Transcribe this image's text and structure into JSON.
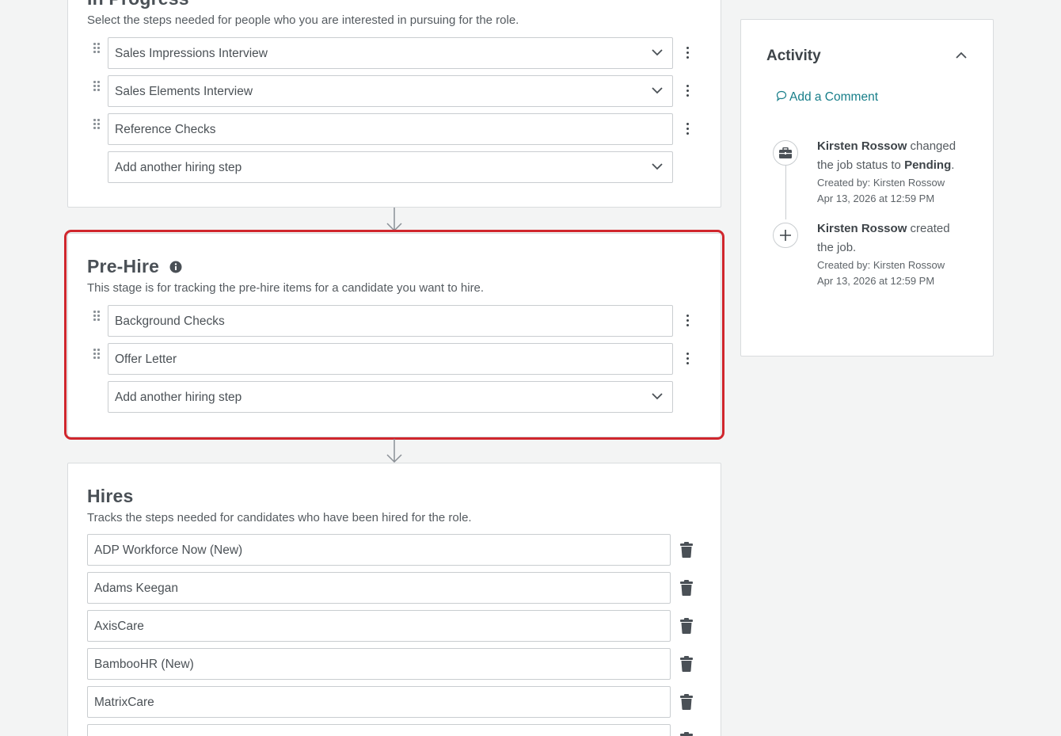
{
  "in_progress": {
    "title": "In Progress",
    "description": "Select the steps needed for people who you are interested in pursuing for the role.",
    "steps": [
      {
        "label": "Sales Impressions Interview"
      },
      {
        "label": "Sales Elements Interview"
      },
      {
        "label": "Reference Checks"
      }
    ],
    "add_step_label": "Add another hiring step"
  },
  "pre_hire": {
    "title": "Pre-Hire",
    "description": "This stage is for tracking the pre-hire items for a candidate you want to hire.",
    "steps": [
      {
        "label": "Background Checks"
      },
      {
        "label": "Offer Letter"
      }
    ],
    "add_step_label": "Add another hiring step",
    "highlight_color": "#d0262d"
  },
  "hires": {
    "title": "Hires",
    "description": "Tracks the steps needed for candidates who have been hired for the role.",
    "items": [
      {
        "label": "ADP Workforce Now (New)"
      },
      {
        "label": "Adams Keegan"
      },
      {
        "label": "AxisCare"
      },
      {
        "label": "BambooHR (New)"
      },
      {
        "label": "MatrixCare"
      },
      {
        "label": ""
      }
    ]
  },
  "activity": {
    "title": "Activity",
    "add_comment_label": "Add a Comment",
    "entries": [
      {
        "icon": "briefcase-icon",
        "actor": "Kirsten Rossow",
        "action": " changed the job status to ",
        "value": "Pending",
        "suffix": ".",
        "created_by": "Created by: Kirsten Rossow",
        "timestamp": "Apr 13, 2026 at 12:59 PM"
      },
      {
        "icon": "plus-icon",
        "actor": "Kirsten Rossow",
        "action": " created the job.",
        "value": "",
        "suffix": "",
        "created_by": "Created by: Kirsten Rossow",
        "timestamp": "Apr 13, 2026 at 12:59 PM"
      }
    ]
  },
  "colors": {
    "accent": "#177e89",
    "background": "#f3f4f4",
    "highlight": "#d0262d"
  }
}
